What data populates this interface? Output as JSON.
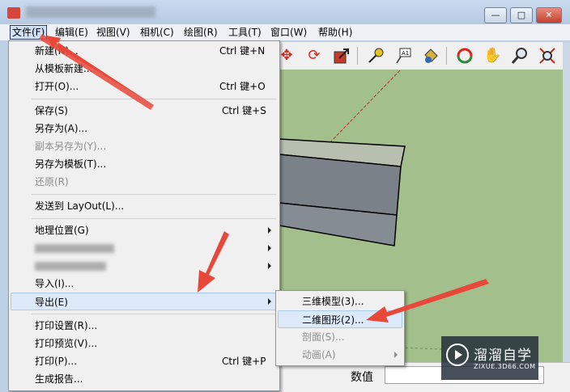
{
  "menubar": {
    "items": [
      "文件(F)",
      "编辑(E)",
      "视图(V)",
      "相机(C)",
      "绘图(R)",
      "工具(T)",
      "窗口(W)",
      "帮助(H)"
    ]
  },
  "window_buttons": {
    "minimize": "—",
    "maximize": "□",
    "close": "✕"
  },
  "file_menu": {
    "new": {
      "label": "新建(N)...",
      "shortcut": "Ctrl 键+N"
    },
    "new_from_template": "从模板新建...",
    "open": {
      "label": "打开(O)...",
      "shortcut": "Ctrl 键+O"
    },
    "save": {
      "label": "保存(S)",
      "shortcut": "Ctrl 键+S"
    },
    "save_as": "另存为(A)...",
    "save_copy_as": "副本另存为(Y)...",
    "save_as_template": "另存为模板(T)...",
    "revert": "还原(R)",
    "send_to_layout": "发送到 LayOut(L)...",
    "geo_location": "地理位置(G)",
    "import": "导入(I)...",
    "export": "导出(E)",
    "print_setup": "打印设置(R)...",
    "print_preview": "打印预览(V)...",
    "print": {
      "label": "打印(P)...",
      "shortcut": "Ctrl 键+P"
    },
    "generate_report": "生成报告..."
  },
  "export_submenu": {
    "model_3d": "三维模型(3)...",
    "graphic_2d": "二维图形(2)...",
    "section": "剖面(S)...",
    "animation": "动画(A)"
  },
  "status_bar": {
    "value_label": "数值"
  },
  "toolbar_icons": [
    "move-icon",
    "rotate-icon",
    "scale-icon",
    "tape-measure-icon",
    "text-icon",
    "paint-bucket-icon",
    "orbit-icon",
    "pan-icon",
    "zoom-icon",
    "zoom-extents-icon"
  ],
  "watermark": {
    "title": "溜溜自学",
    "url": "ZIXUE.3D66.COM"
  },
  "colors": {
    "viewport_bg": "#a3bf8b",
    "annotation_arrow": "#e8483a",
    "highlight": "#dce9f8"
  }
}
